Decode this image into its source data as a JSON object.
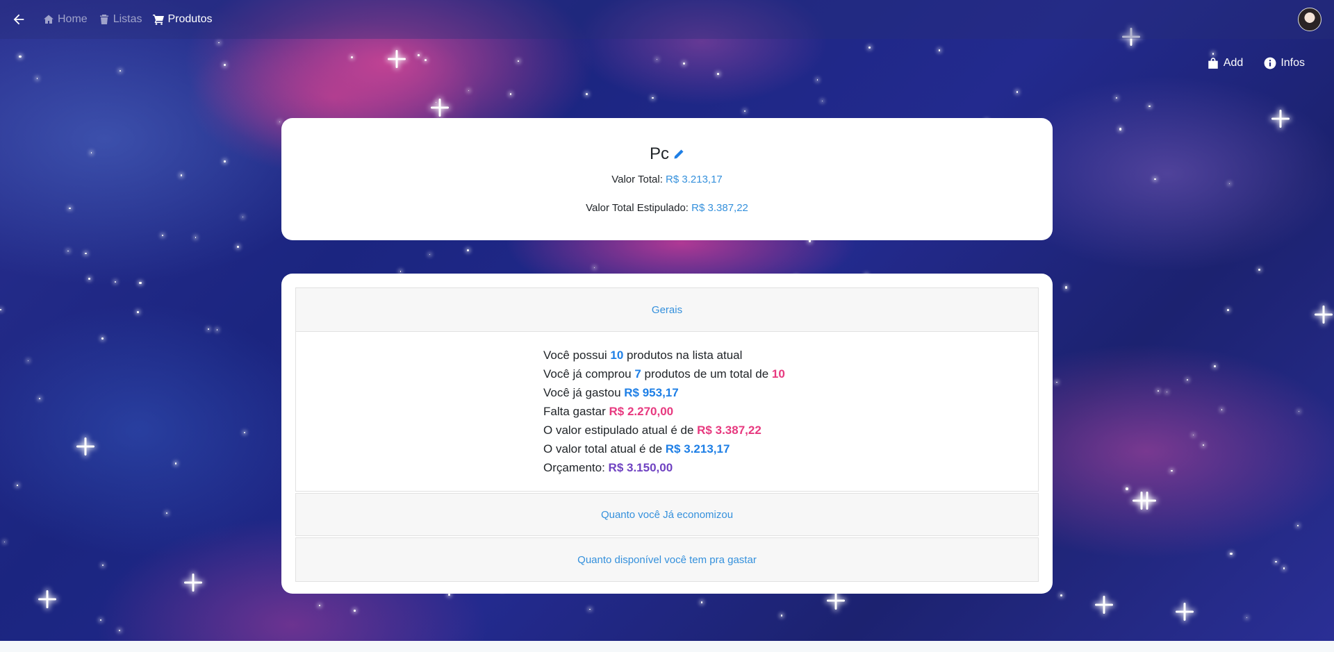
{
  "nav": {
    "links": [
      {
        "label": "Home",
        "icon": "home-icon"
      },
      {
        "label": "Listas",
        "icon": "trash-icon"
      },
      {
        "label": "Produtos",
        "icon": "cart-icon"
      }
    ]
  },
  "actions": {
    "add_label": "Add",
    "infos_label": "Infos"
  },
  "summary": {
    "title": "Pc",
    "total_label": "Valor Total:",
    "total_value": "R$ 3.213,17",
    "estimated_label": "Valor Total Estipulado:",
    "estimated_value": "R$ 3.387,22"
  },
  "accordion": {
    "general_label": "Gerais",
    "saved_label": "Quanto você Já economizou",
    "available_label": "Quanto disponível você tem pra gastar"
  },
  "stats": {
    "line1_pre": "Você possui ",
    "line1_val": "10",
    "line1_post": " produtos na lista atual",
    "line2_pre": "Você já comprou ",
    "line2_val": "7",
    "line2_mid": " produtos de um total de ",
    "line2_total": "10",
    "line3_pre": "Você já gastou ",
    "line3_val": "R$ 953,17",
    "line4_pre": "Falta gastar ",
    "line4_val": "R$ 2.270,00",
    "line5_pre": "O valor estipulado atual é de ",
    "line5_val": "R$ 3.387,22",
    "line6_pre": "O valor total atual é de ",
    "line6_val": "R$ 3.213,17",
    "line7_pre": "Orçamento: ",
    "line7_val": "R$ 3.150,00"
  },
  "colors": {
    "link_blue": "#3490dc",
    "value_blue": "#1e7fe6",
    "value_pink": "#e7397f",
    "value_purple": "#6f42c1"
  }
}
